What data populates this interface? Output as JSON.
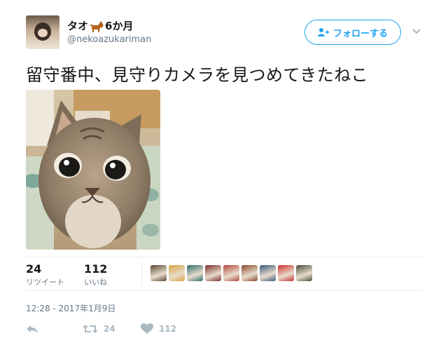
{
  "user": {
    "display_name": "タオ",
    "display_name_suffix": "6か月",
    "handle": "@nekoazukariman"
  },
  "follow_button": {
    "label": "フォローする"
  },
  "tweet": {
    "text": "留守番中、見守りカメラを見つめてきたねこ",
    "timestamp": "12:28 - 2017年1月9日"
  },
  "stats": {
    "retweets": {
      "count": "24",
      "label": "リツイート"
    },
    "likes": {
      "count": "112",
      "label": "いいね"
    }
  },
  "actions": {
    "retweet_count": "24",
    "like_count": "112"
  },
  "likers": [
    {
      "color": "#5a4632"
    },
    {
      "color": "#d9a441"
    },
    {
      "color": "#2f6e6a"
    },
    {
      "color": "#7a2f2a"
    },
    {
      "color": "#b34a3a"
    },
    {
      "color": "#8a4a2a"
    },
    {
      "color": "#3c5878"
    },
    {
      "color": "#c9302c"
    },
    {
      "color": "#4b4f3a"
    }
  ],
  "colors": {
    "accent": "#1da1f2",
    "secondary_text": "#657786",
    "icon_gray": "#aab8c2"
  }
}
